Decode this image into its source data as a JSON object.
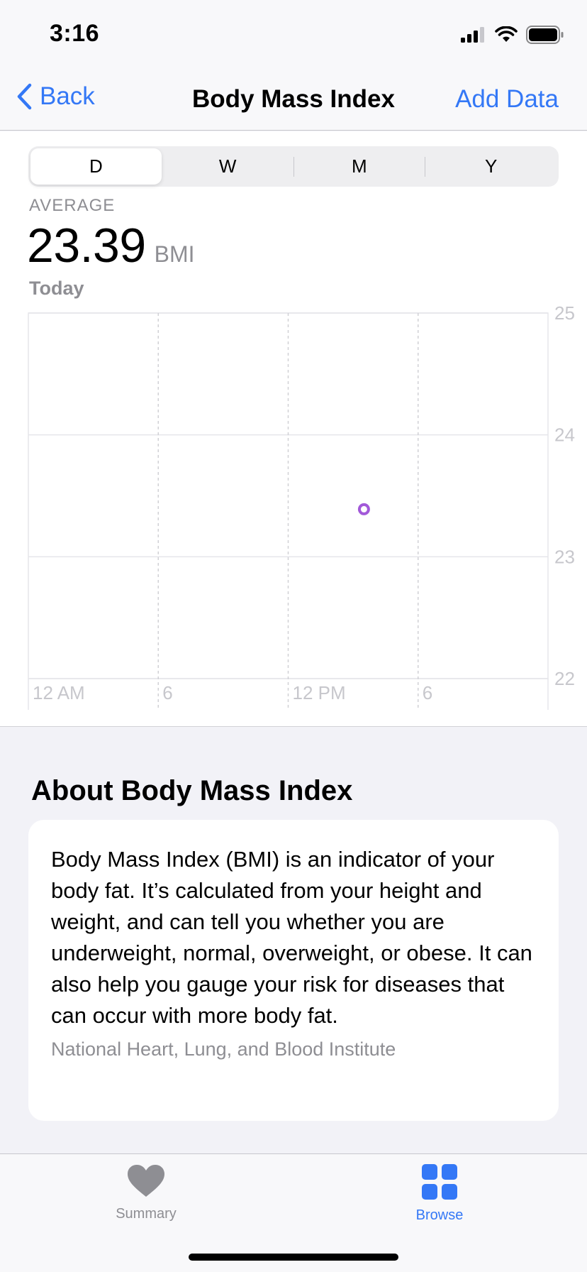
{
  "status_bar": {
    "time": "3:16"
  },
  "nav": {
    "back_label": "Back",
    "title": "Body Mass Index",
    "action_label": "Add Data"
  },
  "segments": [
    {
      "label": "D",
      "selected": true
    },
    {
      "label": "W",
      "selected": false
    },
    {
      "label": "M",
      "selected": false
    },
    {
      "label": "Y",
      "selected": false
    }
  ],
  "summary": {
    "label": "AVERAGE",
    "value": "23.39",
    "unit": "BMI",
    "date_label": "Today"
  },
  "chart_data": {
    "type": "scatter",
    "x_tick_labels": [
      "12 AM",
      "6",
      "12 PM",
      "6"
    ],
    "y_tick_labels": [
      "25",
      "24",
      "23",
      "22"
    ],
    "ylim": [
      22,
      25
    ],
    "xlim_hours": [
      0,
      24
    ],
    "points": [
      {
        "x_hour": 15.5,
        "y": 23.39
      }
    ],
    "point_color": "#a259d9",
    "grid": true
  },
  "about": {
    "title": "About Body Mass Index",
    "text": "Body Mass Index (BMI) is an indicator of your body fat. It’s calculated from your height and weight, and can tell you whether you are underweight, normal, overweight, or obese. It can also help you gauge your risk for diseases that can occur with more body fat.",
    "source": "National Heart, Lung, and Blood Institute"
  },
  "tab_bar": {
    "summary_label": "Summary",
    "browse_label": "Browse",
    "active_tab": "Browse"
  },
  "colors": {
    "accent": "#3478f6",
    "inactive": "#8e8e93",
    "data_point": "#a259d9"
  }
}
